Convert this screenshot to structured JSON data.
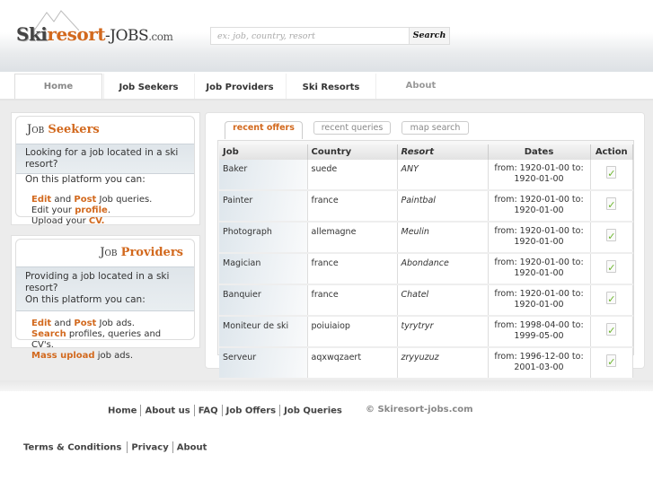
{
  "header": {
    "logo": {
      "ski": "Ski",
      "resort": "resort",
      "jobs": "-JOBS",
      "com": ".com"
    },
    "search": {
      "placeholder": "ex: job, country, resort",
      "button": "Search"
    }
  },
  "nav": [
    {
      "label": "Home",
      "active": true
    },
    {
      "label": "Job Seekers"
    },
    {
      "label": "Job Providers"
    },
    {
      "label": "Ski Resorts"
    },
    {
      "label": "About"
    }
  ],
  "seekers": {
    "title_a": "Job",
    "title_b": "Seekers",
    "intro": "Looking for a job located in a ski resort?",
    "intro2": "On this platform you can:",
    "edit": "Edit",
    "and": " and ",
    "post": "Post",
    "queries": " Job queries.",
    "edit_your": "Edit your ",
    "profile": "profile",
    "dot": ".",
    "upload": "Upload your ",
    "cv": "CV."
  },
  "providers": {
    "title_a": "Job",
    "title_b": "Providers",
    "intro": "Providing a job located in a ski resort?",
    "intro2": "On this platform you can:",
    "edit": "Edit",
    "and": " and ",
    "post": "Post",
    "ads": " Job ads.",
    "search": "Search",
    "search_rest": " profiles, queries and CV's.",
    "mass": "Mass upload",
    "mass_rest": " job ads."
  },
  "panel_tabs": [
    {
      "label": "recent offers",
      "active": true
    },
    {
      "label": "recent queries"
    },
    {
      "label": "map search"
    }
  ],
  "table": {
    "headers": [
      "Job",
      "Country",
      "Resort",
      "Dates",
      "Action"
    ],
    "rows": [
      {
        "job": "Baker",
        "country": "suede",
        "resort": "ANY",
        "from": "from: 1920-01-00 to:",
        "to": "1920-01-00"
      },
      {
        "job": "Painter",
        "country": "france",
        "resort": "Paintbal",
        "from": "from: 1920-01-00 to:",
        "to": "1920-01-00"
      },
      {
        "job": "Photograph",
        "country": "allemagne",
        "resort": "Meulin",
        "from": "from: 1920-01-00 to:",
        "to": "1920-01-00"
      },
      {
        "job": "Magician",
        "country": "france",
        "resort": "Abondance",
        "from": "from: 1920-01-00 to:",
        "to": "1920-01-00"
      },
      {
        "job": "Banquier",
        "country": "france",
        "resort": "Chatel",
        "from": "from: 1920-01-00 to:",
        "to": "1920-01-00"
      },
      {
        "job": "Moniteur de ski",
        "country": "poiuiaiop",
        "resort": "tyrytryr",
        "from": "from: 1998-04-00 to:",
        "to": "1999-05-00"
      },
      {
        "job": "Serveur",
        "country": "aqxwqzaert",
        "resort": "zryyuzuz",
        "from": "from: 1996-12-00 to:",
        "to": "2001-03-00"
      }
    ],
    "action_icon": "accept-document-icon"
  },
  "footer": {
    "links": [
      "Home",
      "About us",
      "FAQ",
      "Job Offers",
      "Job Queries"
    ],
    "copyright": "© Skiresort-jobs.com",
    "legal": [
      "Terms & Conditions",
      "Privacy",
      "About"
    ]
  },
  "colors": {
    "accent": "#d2691e",
    "check": "#6bb52b"
  }
}
